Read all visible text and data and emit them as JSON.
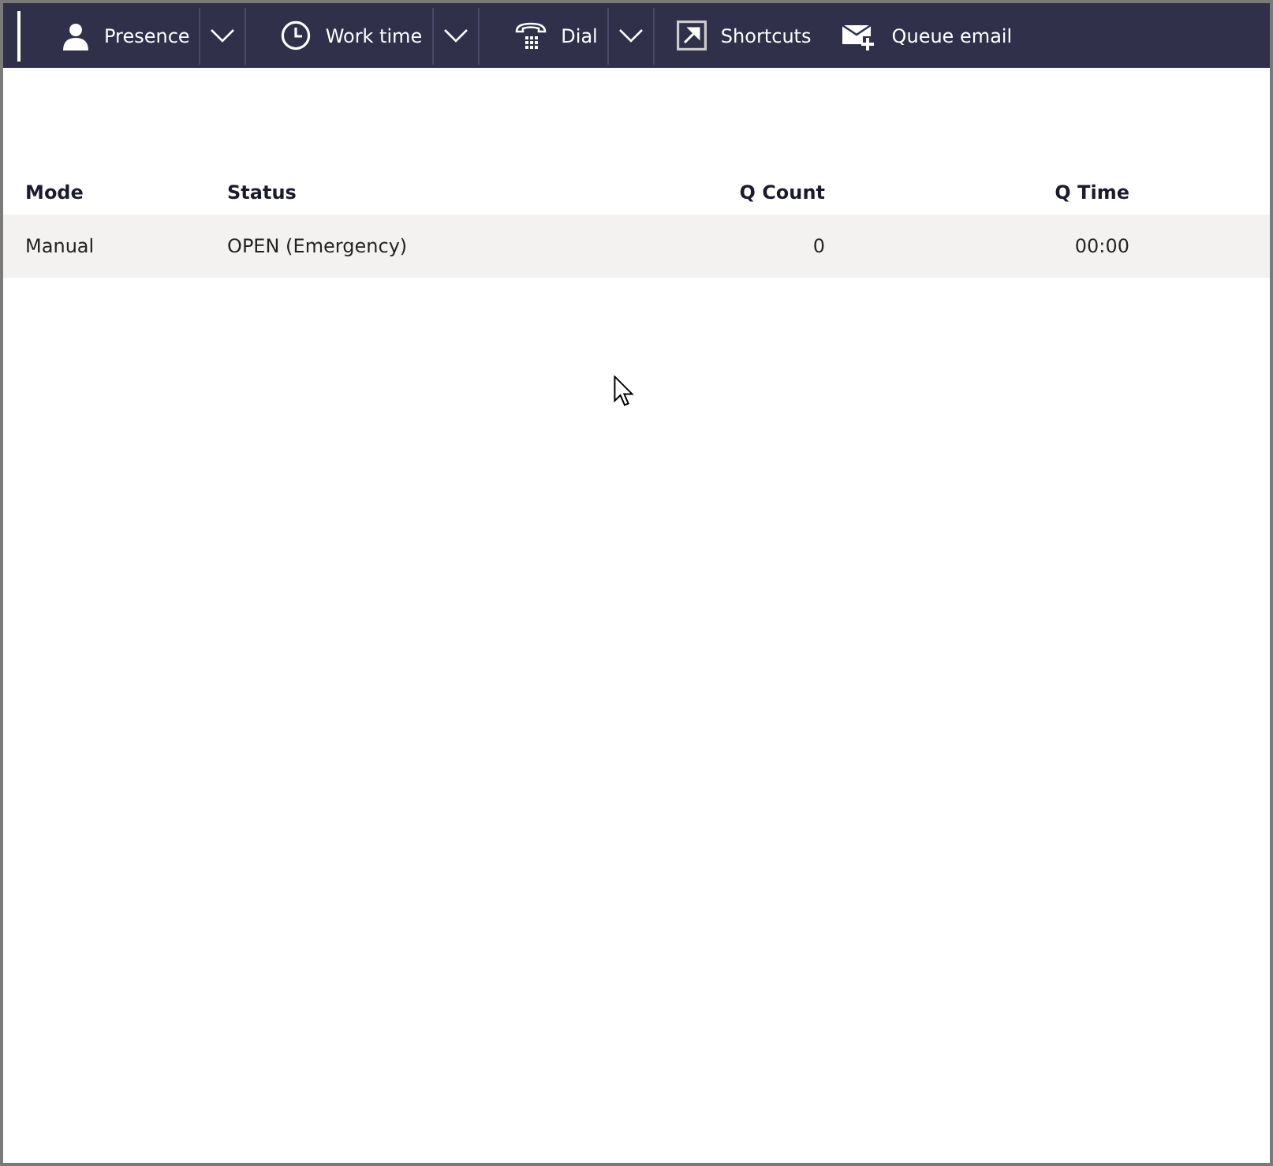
{
  "toolbar": {
    "items": [
      {
        "label": "Presence",
        "kind": "split"
      },
      {
        "label": "Work time",
        "kind": "split"
      },
      {
        "label": "Dial",
        "kind": "split"
      },
      {
        "label": "Shortcuts",
        "kind": "button"
      },
      {
        "label": "Queue email",
        "kind": "button"
      }
    ]
  },
  "table": {
    "columns": [
      "Mode",
      "Status",
      "Q Count",
      "Q Time"
    ],
    "rows": [
      [
        "Manual",
        "OPEN (Emergency)",
        "0",
        "00:00"
      ]
    ]
  }
}
